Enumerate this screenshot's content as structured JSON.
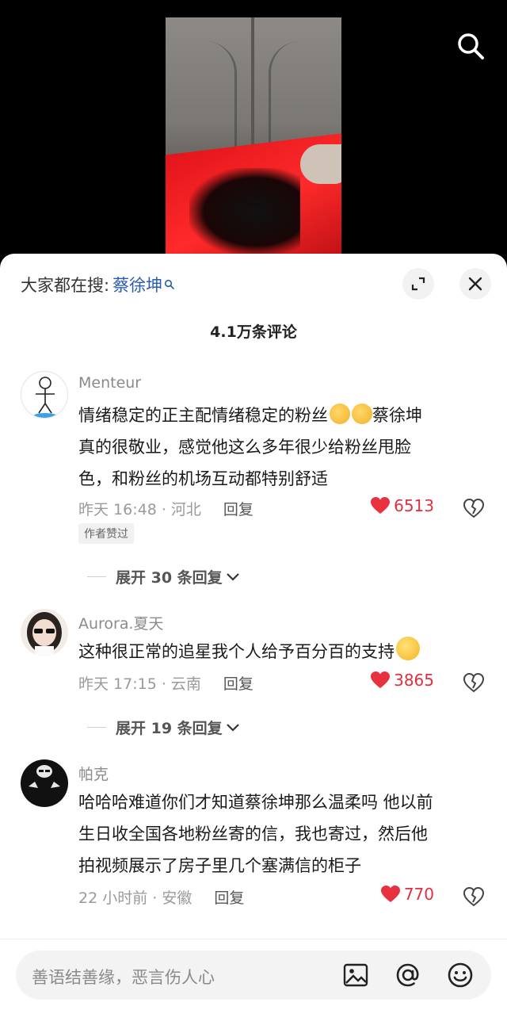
{
  "sheet_header": {
    "trending_label": "大家都在搜:",
    "trending_term": "蔡徐坤"
  },
  "comment_count": "4.1万条评论",
  "comments": [
    {
      "username": "Menteur",
      "lines": [
        "情绪稳定的正主配情绪稳定的粉丝",
        "真的很敬业，感觉他这么多年很少给粉丝甩脸",
        "色，和粉丝的机场互动都特别舒适"
      ],
      "line1_suffix": "蔡徐坤",
      "time_location": "昨天 16:48 · 河北",
      "reply_label": "回复",
      "likes": "6513",
      "badge": "作者赞过",
      "expand_label": "展开 30 条回复"
    },
    {
      "username": "Aurora.夏天",
      "lines": [
        "这种很正常的追星我个人给予百分百的支持"
      ],
      "time_location": "昨天 17:15 · 云南",
      "reply_label": "回复",
      "likes": "3865",
      "expand_label": "展开 19 条回复"
    },
    {
      "username": "帕克",
      "lines": [
        "哈哈哈难道你们才知道蔡徐坤那么温柔吗 他以前",
        "生日收全国各地粉丝寄的信，我也寄过，然后他",
        "拍视频展示了房子里几个塞满信的柜子"
      ],
      "time_location": "22 小时前 · 安徽",
      "reply_label": "回复",
      "likes": "770"
    }
  ],
  "input": {
    "placeholder": "善语结善缘，恶言伤人心"
  },
  "colors": {
    "accent_blue": "#2a5cad",
    "like_red": "#e03040"
  },
  "icons": [
    "search-icon",
    "expand-icon",
    "close-icon",
    "heart-icon",
    "broken-heart-icon",
    "chevron-down-icon",
    "image-icon",
    "at-icon",
    "emoji-icon"
  ]
}
